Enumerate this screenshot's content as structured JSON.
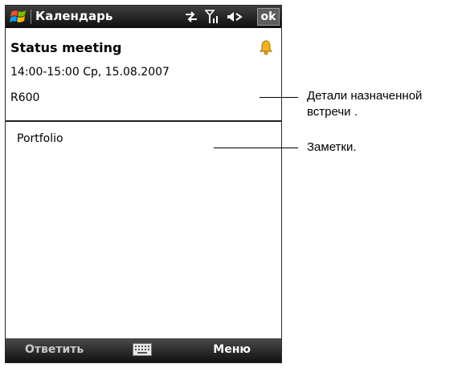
{
  "titlebar": {
    "app_title": "Календарь",
    "ok_label": "ok",
    "icons": [
      "windows-start-icon",
      "connectivity-icon",
      "signal-icon",
      "speaker-icon"
    ]
  },
  "appointment": {
    "subject": "Status meeting",
    "datetime": "14:00-15:00 Ср, 15.08.2007",
    "location": "R600",
    "reminder_icon": "bell-icon"
  },
  "notes": {
    "text": "Portfolio"
  },
  "menubar": {
    "left_softkey": "Ответить",
    "right_softkey": "Меню",
    "input_icon": "keyboard-icon"
  },
  "callouts": {
    "details_line1": "Детали назначенной",
    "details_line2": "встречи .",
    "notes": "Заметки."
  }
}
